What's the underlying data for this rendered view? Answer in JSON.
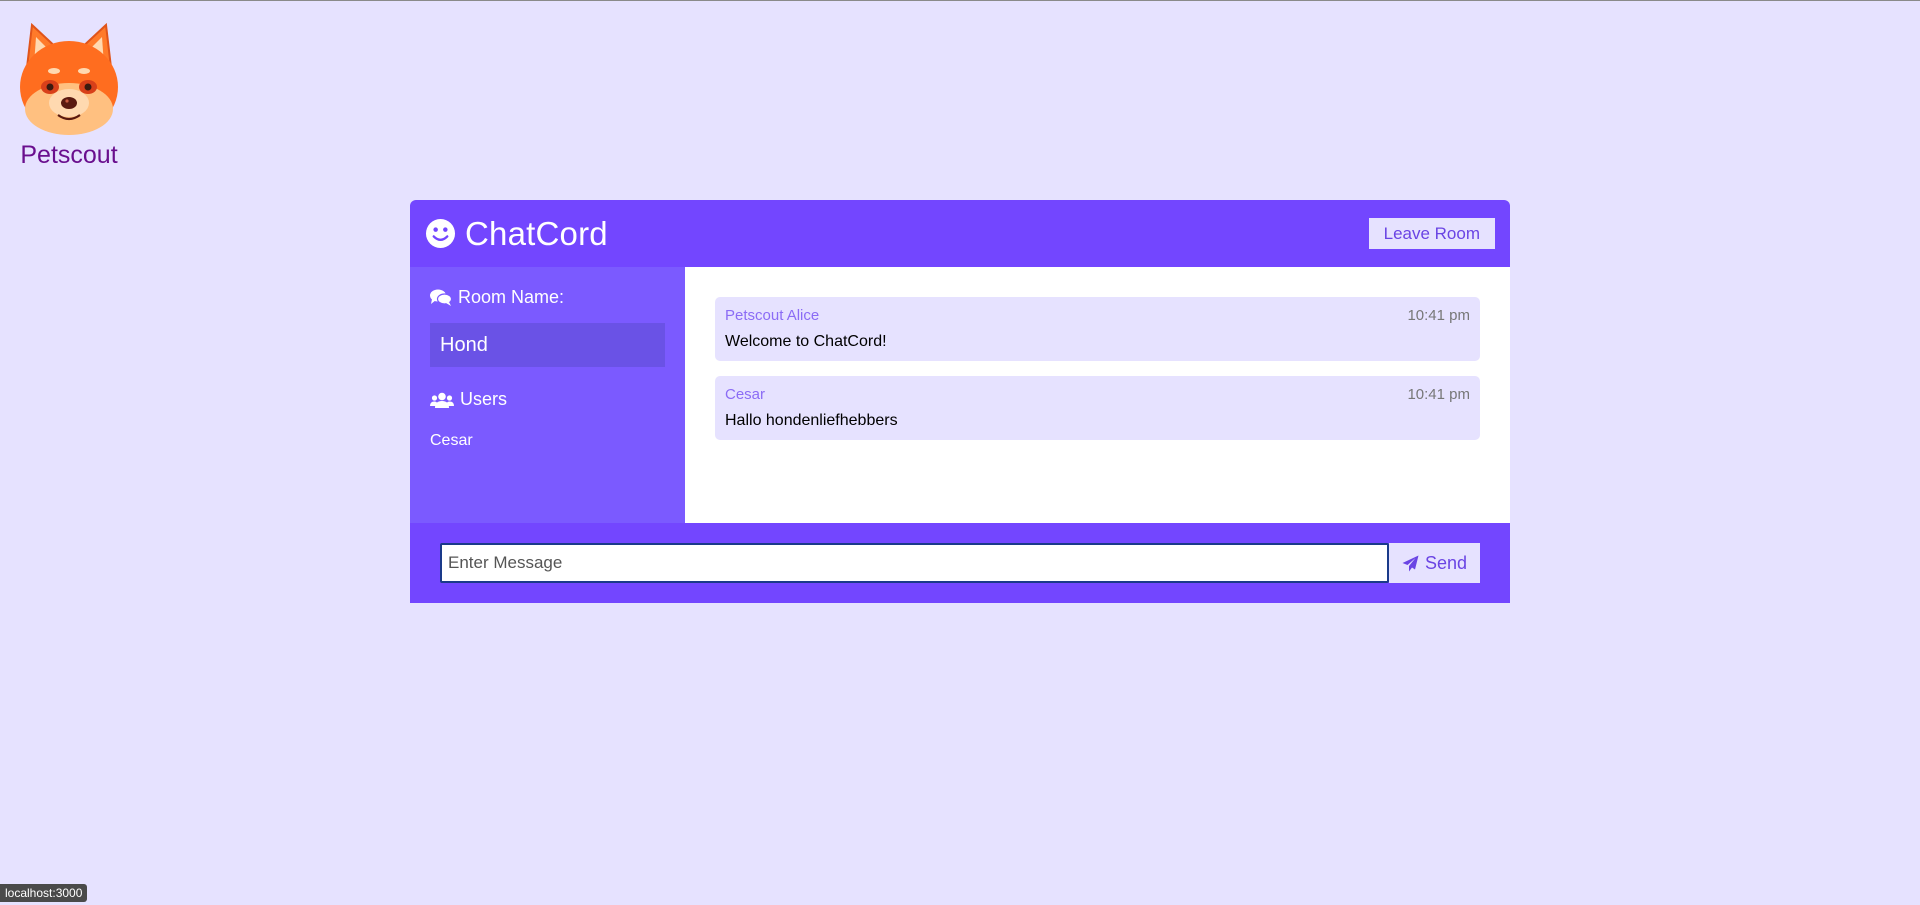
{
  "logo": {
    "text": "Petscout",
    "icon": "shiba-dog-icon"
  },
  "header": {
    "title": "ChatCord",
    "icon": "smiley-icon",
    "leave_label": "Leave Room"
  },
  "sidebar": {
    "room_heading": "Room Name:",
    "room_icon": "comments-icon",
    "room_name": "Hond",
    "users_heading": "Users",
    "users_icon": "users-icon",
    "users": [
      "Cesar"
    ]
  },
  "messages": [
    {
      "user": "Petscout Alice",
      "time": "10:41 pm",
      "text": "Welcome to ChatCord!"
    },
    {
      "user": "Cesar",
      "time": "10:41 pm",
      "text": "Hallo hondenliefhebbers"
    }
  ],
  "form": {
    "placeholder": "Enter Message",
    "send_label": "Send",
    "send_icon": "paper-plane-icon"
  },
  "status_bar": {
    "url": "localhost:3000"
  },
  "colors": {
    "background": "#e6e2ff",
    "header": "#7346ff",
    "sidebar": "#7b5aff",
    "accent_text": "#6a44e4",
    "logo_text": "#6a0f8e"
  }
}
